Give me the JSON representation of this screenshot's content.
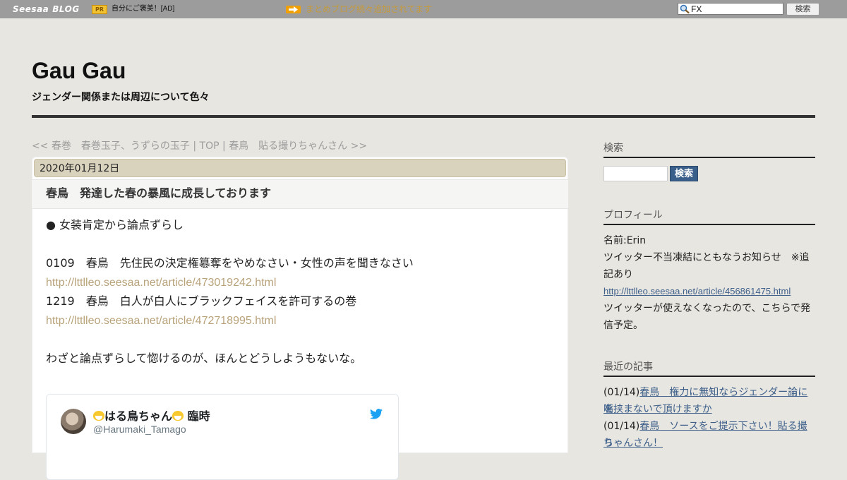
{
  "topbar": {
    "logo": "Seesaa",
    "logo_blog": "BLOG",
    "pr_badge": "PR",
    "pr_text": "自分にご褒美！[AD]",
    "notice_text": "まとめブログ続々追加されてます",
    "search_value": "FX",
    "search_button": "検索"
  },
  "header": {
    "title": "Gau Gau",
    "description": "ジェンダー関係または周辺について色々"
  },
  "nav": {
    "prev": "<< 春巻　春巻玉子、うずらの玉子",
    "sep1": " | ",
    "top": "TOP",
    "sep2": " | ",
    "next": "春鳥　貼る撮りちゃんさん >>"
  },
  "post": {
    "date": "2020年01月12日",
    "title": "春鳥　発達した春の暴風に成長しております",
    "lines": [
      "● 女装肯定から論点ずらし",
      "0109　春鳥　先住民の決定権簒奪をやめなさい・女性の声を聞きなさい",
      "http://lttlleo.seesaa.net/article/473019242.html",
      "1219　春鳥　白人が白人にブラックフェイスを許可するの巻",
      "http://lttlleo.seesaa.net/article/472718995.html",
      "わざと論点ずらして惚けるのが、ほんとどうしようもないな。"
    ],
    "tweet": {
      "name": "はる鳥ちゃん",
      "name_suffix": "臨時",
      "handle": "@Harumaki_Tamago"
    }
  },
  "sidebar": {
    "search": {
      "heading": "検索",
      "button": "検索"
    },
    "profile": {
      "heading": "プロフィール",
      "name": "名前:Erin",
      "line1": "ツイッター不当凍結にともなうお知らせ　※追",
      "line2": "記あり",
      "link": "http://lttlleo.seesaa.net/article/456861475.html",
      "line3": "ツイッターが使えなくなったので、こちらで発",
      "line4": "信予定。"
    },
    "recent": {
      "heading": "最近の記事",
      "items": [
        {
          "date": "(01/14)",
          "title_a": "春鳥　権力に無知ならジェンダー論に嘴",
          "title_b": "を挟まないで頂けますか"
        },
        {
          "date": "(01/14)",
          "title_a": "春鳥　ソースをご提示下さい！貼る撮り",
          "title_b": "ちゃんさん！"
        }
      ]
    }
  },
  "colors": {
    "topbar": "#9c9c9c",
    "background": "#e8e6e1",
    "date_bar": "#d9d2bd",
    "link_muted": "#b9a37a",
    "sidebar_link": "#3d5f8a",
    "search_button": "#3a5f8a",
    "twitter_blue": "#1da1f2"
  }
}
